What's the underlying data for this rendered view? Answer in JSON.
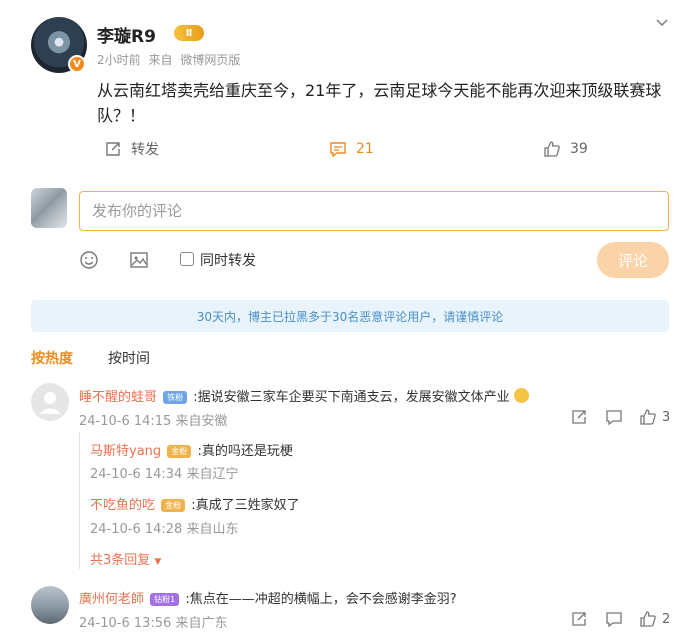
{
  "post": {
    "author": "李璇R9",
    "level_badge": "Ⅱ",
    "verified_mark": "V",
    "time": "2小时前",
    "source": "来自",
    "client": "微博网页版",
    "text": "从云南红塔卖壳给重庆至今，21年了，云南足球今天能不能再次迎来顶级联赛球队？！",
    "repost_label": "转发",
    "comment_count": "21",
    "like_count": "39"
  },
  "composer": {
    "placeholder": "发布你的评论",
    "repost_option": "同时转发",
    "submit": "评论"
  },
  "notice": "30天内，博主已拉黑多于30名恶意评论用户，请谨慎评论",
  "sort": {
    "hot": "按热度",
    "time": "按时间"
  },
  "comments": [
    {
      "name": "睡不醒的蛙哥",
      "badge": "铁粉",
      "text": ":据说安徽三家车企要买下南通支云，发展安徽文体产业",
      "time": "24-10-6 14:15 来自安徽",
      "likes": "3",
      "replies": [
        {
          "name": "马斯特yang",
          "badge": "金粉",
          "text": ":真的吗还是玩梗",
          "time": "24-10-6 14:34 来自辽宁"
        },
        {
          "name": "不吃鱼的吃",
          "badge": "金粉",
          "text": ":真成了三姓家奴了",
          "time": "24-10-6 14:28 来自山东"
        }
      ],
      "more_replies": "共3条回复"
    },
    {
      "name": "廣州何老師",
      "badge": "钻粉1",
      "text": ":焦点在——冲超的横幅上，会不会感谢李金羽?",
      "time": "24-10-6 13:56 来自广东",
      "likes": "2"
    }
  ],
  "colors": {
    "accent": "#f08b1c",
    "name": "#eb7350",
    "notice_bg": "#e8f3fb",
    "notice_text": "#4a90c9",
    "submit_bg": "#fbd3a9"
  }
}
